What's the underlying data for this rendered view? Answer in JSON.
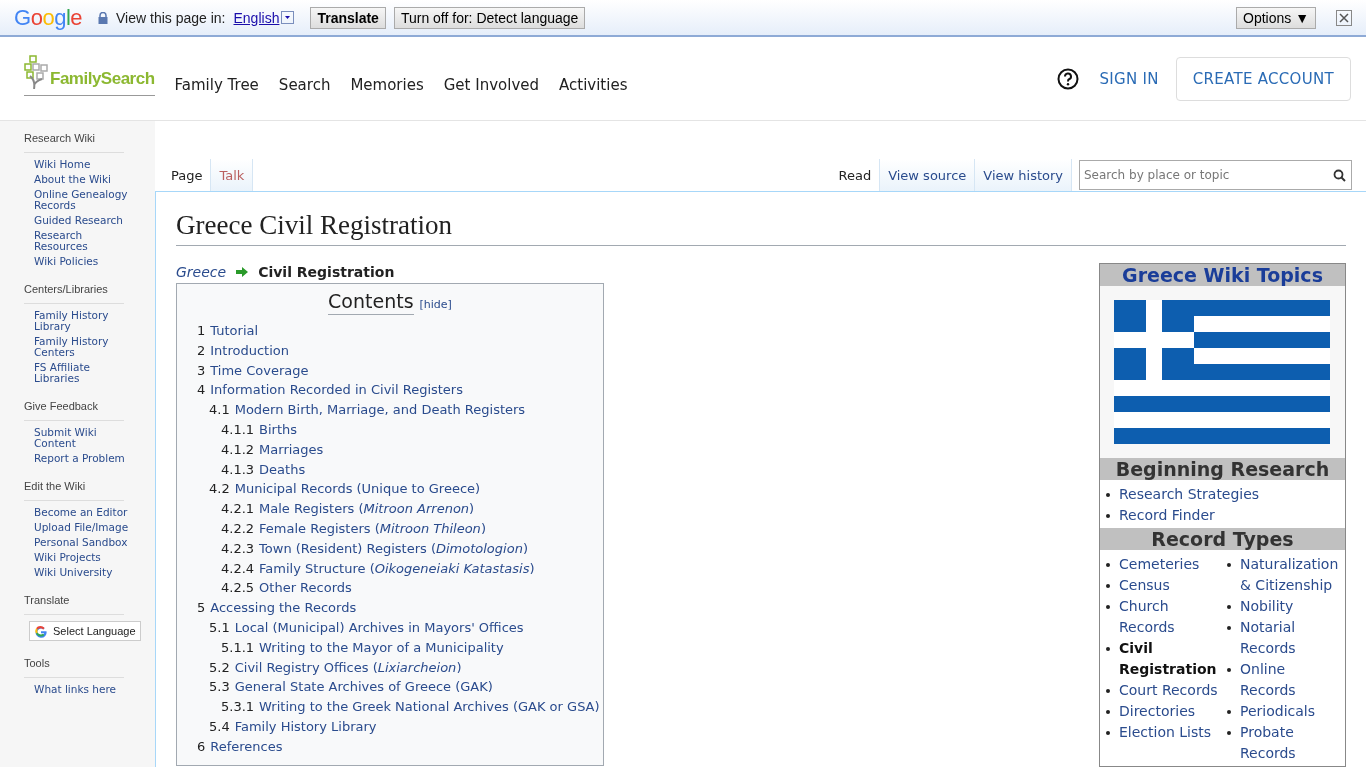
{
  "translate_bar": {
    "brand": "Google",
    "prompt": "View this page in:",
    "language": "English",
    "translate_button": "Translate",
    "turn_off_button": "Turn off for: Detect language",
    "options_button": "Options ▼"
  },
  "header": {
    "logo": "FamilySearch",
    "nav": [
      "Family Tree",
      "Search",
      "Memories",
      "Get Involved",
      "Activities"
    ],
    "sign_in": "SIGN IN",
    "create_account": "CREATE ACCOUNT"
  },
  "sidebar": {
    "sections": [
      {
        "title": "Research Wiki",
        "items": [
          "Wiki Home",
          "About the Wiki",
          "Online Genealogy Records",
          "Guided Research",
          "Research Resources",
          "Wiki Policies"
        ]
      },
      {
        "title": "Centers/Libraries",
        "items": [
          "Family History Library",
          "Family History Centers",
          "FS Affiliate Libraries"
        ]
      },
      {
        "title": "Give Feedback",
        "items": [
          "Submit Wiki Content",
          "Report a Problem"
        ]
      },
      {
        "title": "Edit the Wiki",
        "items": [
          "Become an Editor",
          "Upload File/Image",
          "Personal Sandbox",
          "Wiki Projects",
          "Wiki University"
        ]
      },
      {
        "title": "Translate",
        "kind": "translate",
        "button": "Select Language"
      },
      {
        "title": "Tools",
        "items": [
          "What links here"
        ]
      }
    ]
  },
  "page_tabs": [
    {
      "label": "Page",
      "selected": true,
      "missing": false
    },
    {
      "label": "Talk",
      "selected": false,
      "missing": true
    }
  ],
  "view_tabs": [
    {
      "label": "Read",
      "selected": true
    },
    {
      "label": "View source",
      "selected": false
    },
    {
      "label": "View history",
      "selected": false
    }
  ],
  "search": {
    "placeholder": "Search by place or topic"
  },
  "title": "Greece Civil Registration",
  "breadcrumb": {
    "parent": "Greece",
    "current": "Civil Registration"
  },
  "toc": {
    "title": "Contents",
    "toggle": "[hide]",
    "items": [
      {
        "number": "1",
        "text": "Tutorial"
      },
      {
        "number": "2",
        "text": "Introduction"
      },
      {
        "number": "3",
        "text": "Time Coverage"
      },
      {
        "number": "4",
        "text": "Information Recorded in Civil Registers",
        "children": [
          {
            "number": "4.1",
            "text": "Modern Birth, Marriage, and Death Registers",
            "children": [
              {
                "number": "4.1.1",
                "text": "Births"
              },
              {
                "number": "4.1.2",
                "text": "Marriages"
              },
              {
                "number": "4.1.3",
                "text": "Deaths"
              }
            ]
          },
          {
            "number": "4.2",
            "text": "Municipal Records (Unique to Greece)",
            "children": [
              {
                "number": "4.2.1",
                "text": "Male Registers (*Mitroon Arrenon*)"
              },
              {
                "number": "4.2.2",
                "text": "Female Registers (*Mitroon Thileon*)"
              },
              {
                "number": "4.2.3",
                "text": "Town (Resident) Registers (*Dimotologion*)"
              },
              {
                "number": "4.2.4",
                "text": "Family Structure (*Oikogeneiaki Katastasis*)"
              },
              {
                "number": "4.2.5",
                "text": "Other Records"
              }
            ]
          }
        ]
      },
      {
        "number": "5",
        "text": "Accessing the Records",
        "children": [
          {
            "number": "5.1",
            "text": "Local (Municipal) Archives in Mayors' Offices",
            "children": [
              {
                "number": "5.1.1",
                "text": "Writing to the Mayor of a Municipality"
              }
            ]
          },
          {
            "number": "5.2",
            "text": "Civil Registry Offices (*Lixiarcheion*)"
          },
          {
            "number": "5.3",
            "text": "General State Archives of Greece (GAK)",
            "children": [
              {
                "number": "5.3.1",
                "text": "Writing to the Greek National Archives (GAK or GSA)"
              }
            ]
          },
          {
            "number": "5.4",
            "text": "Family History Library"
          }
        ]
      },
      {
        "number": "6",
        "text": "References"
      }
    ]
  },
  "infobox": {
    "title": "Greece Wiki Topics",
    "sections": [
      {
        "title": "Beginning Research",
        "columns": [
          [
            {
              "text": "Research Strategies",
              "selected": false
            },
            {
              "text": "Record Finder",
              "selected": false
            }
          ]
        ]
      },
      {
        "title": "Record Types",
        "columns": [
          [
            {
              "text": "Cemeteries",
              "selected": false
            },
            {
              "text": "Census",
              "selected": false
            },
            {
              "text": "Church Records",
              "selected": false
            },
            {
              "text": "Civil Registration",
              "selected": true
            },
            {
              "text": "Court Records",
              "selected": false
            },
            {
              "text": "Directories",
              "selected": false
            },
            {
              "text": "Election Lists",
              "selected": false
            }
          ],
          [
            {
              "text": "Naturalization & Citizenship",
              "selected": false
            },
            {
              "text": "Nobility",
              "selected": false
            },
            {
              "text": "Notarial Records",
              "selected": false
            },
            {
              "text": "Online Records",
              "selected": false
            },
            {
              "text": "Periodicals",
              "selected": false
            },
            {
              "text": "Probate Records",
              "selected": false
            }
          ]
        ]
      }
    ]
  }
}
